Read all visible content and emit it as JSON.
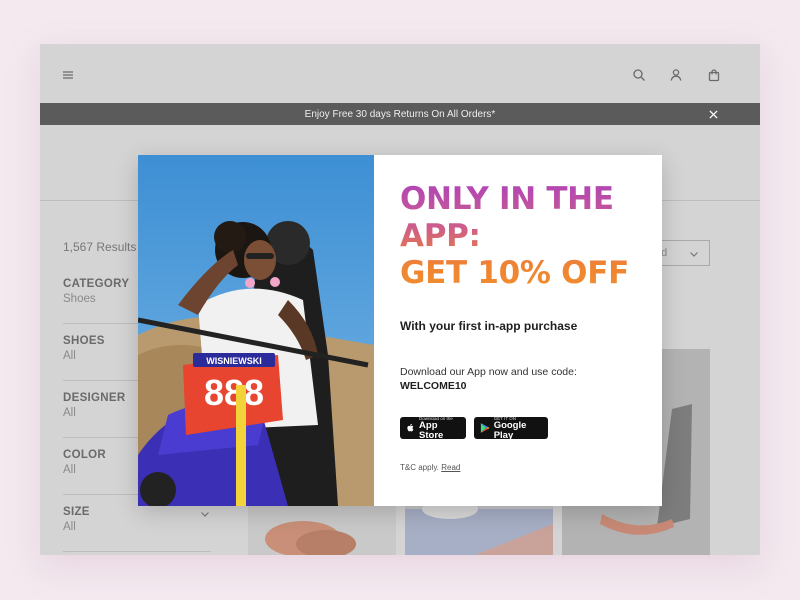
{
  "header": {
    "menu_icon": "hamburger-icon",
    "search_icon": "search-icon",
    "account_icon": "user-icon",
    "cart_icon": "shopping-bag-icon"
  },
  "promo_bar": {
    "text": "Enjoy Free 30 days Returns On All Orders*",
    "close_icon": "close-icon"
  },
  "listing": {
    "results": "1,567 Results",
    "sort_label": "ed"
  },
  "filters": [
    {
      "title": "CATEGORY",
      "value": "Shoes"
    },
    {
      "title": "SHOES",
      "value": "All"
    },
    {
      "title": "DESIGNER",
      "value": "All"
    },
    {
      "title": "COLOR",
      "value": "All"
    },
    {
      "title": "SIZE",
      "value": "All"
    }
  ],
  "modal": {
    "headline_1": "ONLY IN THE",
    "headline_2": "APP:",
    "headline_3": "GET 10% OFF",
    "subhead": "With your first in-app purchase",
    "download_text": "Download our App now and use code:",
    "code": "WELCOME10",
    "app_store_small": "Download on the",
    "app_store_big": "App Store",
    "google_play_small": "GET IT ON",
    "google_play_big": "Google Play",
    "tc_text": "T&C apply.",
    "tc_link": "Read",
    "bike_number": "888",
    "bike_name": "WISNIEWSKI"
  },
  "colors": {
    "gradient_top": "#b044b8",
    "gradient_bottom": "#f18f2e",
    "promo_bg": "#5b5b5b",
    "overlay": "#d4d4d4"
  }
}
